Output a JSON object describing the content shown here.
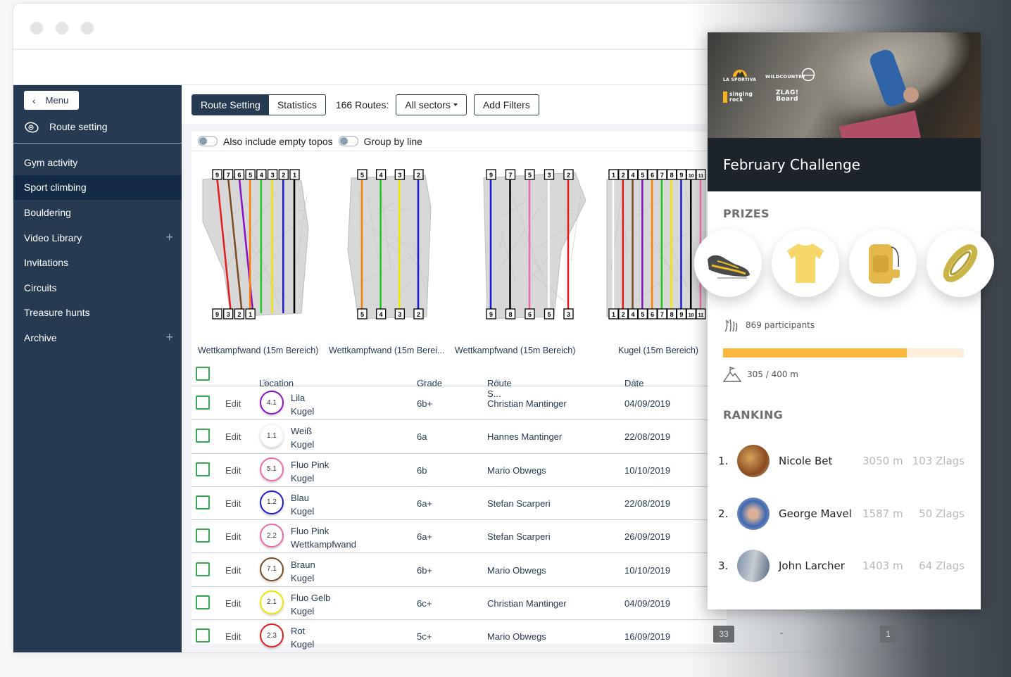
{
  "window": {
    "title_dots": [
      "close",
      "minimize",
      "maximize"
    ]
  },
  "sidebar": {
    "menu_button": "Menu",
    "section": {
      "label": "Route setting",
      "icon": "climbing-hold-icon"
    },
    "items": [
      {
        "label": "Gym activity",
        "active": false,
        "expandable": false
      },
      {
        "label": "Sport climbing",
        "active": true,
        "expandable": false
      },
      {
        "label": "Bouldering",
        "active": false,
        "expandable": false
      },
      {
        "label": "Video Library",
        "active": false,
        "expandable": true
      },
      {
        "label": "Invitations",
        "active": false,
        "expandable": false
      },
      {
        "label": "Circuits",
        "active": false,
        "expandable": false
      },
      {
        "label": "Treasure hunts",
        "active": false,
        "expandable": false
      },
      {
        "label": "Archive",
        "active": false,
        "expandable": true
      }
    ],
    "expand_symbol": "+"
  },
  "toolbar": {
    "tabs": [
      {
        "label": "Route Setting",
        "active": true
      },
      {
        "label": "Statistics",
        "active": false
      }
    ],
    "route_count": "166 Routes:",
    "sector_select": "All sectors",
    "add_filters": "Add Filters"
  },
  "toggles": [
    {
      "label": "Also include empty topos",
      "on": false
    },
    {
      "label": "Group by line",
      "on": false
    }
  ],
  "topos": [
    {
      "label": "Wettkampfwand (15m Bereich)",
      "top_numbers": [
        "9",
        "7",
        "6",
        "5",
        "4",
        "3",
        "2",
        "1"
      ],
      "bottom_numbers": [
        "9",
        "3",
        "2",
        "1"
      ]
    },
    {
      "label": "Wettkampfwand (15m Berei...",
      "top_numbers": [
        "5",
        "4",
        "3",
        "2"
      ],
      "bottom_numbers": [
        "5",
        "4",
        "3",
        "2"
      ]
    },
    {
      "label": "Wettkampfwand (15m Bereich)",
      "top_numbers": [
        "9",
        "7",
        "5",
        "3",
        "2"
      ],
      "bottom_numbers": [
        "9",
        "8",
        "6",
        "5",
        "3"
      ]
    },
    {
      "label": "Kugel (15m Bereich)",
      "top_numbers": [
        "1",
        "2",
        "4",
        "5",
        "6",
        "7",
        "8",
        "9",
        "10",
        "11"
      ],
      "bottom_numbers": [
        "1",
        "2",
        "4",
        "5",
        "6",
        "7",
        "8",
        "9",
        "10",
        "11"
      ]
    }
  ],
  "table": {
    "columns": [
      "Location",
      "Grade",
      "Route S...",
      "Date"
    ],
    "sort_icon": "⇅",
    "edit_label": "Edit",
    "rows": [
      {
        "number": "4.1",
        "color": "#8a12c4",
        "color_name": "Lila",
        "location": "Kugel",
        "grade": "6b+",
        "setter": "Christian Mantinger",
        "date": "04/09/2019"
      },
      {
        "number": "1.1",
        "color": "#ffffff",
        "color_name": "Weiß",
        "location": "Kugel",
        "grade": "6a",
        "setter": "Hannes Mantinger",
        "date": "22/08/2019"
      },
      {
        "number": "5.1",
        "color": "#f06aa8",
        "color_name": "Fluo Pink",
        "location": "Kugel",
        "grade": "6b",
        "setter": "Mario Obwegs",
        "date": "10/10/2019"
      },
      {
        "number": "1.2",
        "color": "#1a1ad6",
        "color_name": "Blau",
        "location": "Kugel",
        "grade": "6a+",
        "setter": "Stefan Scarperi",
        "date": "22/08/2019"
      },
      {
        "number": "2.2",
        "color": "#f06aa8",
        "color_name": "Fluo Pink",
        "location": "Wettkampfwand",
        "grade": "6a+",
        "setter": "Stefan Scarperi",
        "date": "26/09/2019"
      },
      {
        "number": "7.1",
        "color": "#7a4a22",
        "color_name": "Braun",
        "location": "Kugel",
        "grade": "6b+",
        "setter": "Mario Obwegs",
        "date": "10/10/2019"
      },
      {
        "number": "2.1",
        "color": "#f2e600",
        "color_name": "Fluo Gelb",
        "location": "Kugel",
        "grade": "6c+",
        "setter": "Christian Mantinger",
        "date": "04/09/2019"
      },
      {
        "number": "2.3",
        "color": "#e21c1c",
        "color_name": "Rot",
        "location": "Kugel",
        "grade": "5c+",
        "setter": "Mario Obwegs",
        "date": "16/09/2019"
      }
    ],
    "last_row_extra": {
      "count_badge": "33",
      "dash": "-",
      "page_badge": "1"
    }
  },
  "challenge": {
    "sponsors": [
      "LA SPORTIVA",
      "WILDCOUNTRY",
      "singing rock",
      "ZLAG! Board"
    ],
    "title": "February Challenge",
    "prizes_heading": "PRIZES",
    "prizes": [
      "climbing-shoe",
      "t-shirt",
      "backpack",
      "rope"
    ],
    "participants": "869 participants",
    "progress": {
      "current": 305,
      "goal": 400,
      "unit": "m",
      "label": "305 / 400 m"
    },
    "progress_fraction": 0.7625,
    "ranking_heading": "RANKING",
    "ranking": [
      {
        "position": "1.",
        "name": "Nicole Bet",
        "meters": "3050 m",
        "zlags": "103 Zlags"
      },
      {
        "position": "2.",
        "name": "George Mavel",
        "meters": "1587 m",
        "zlags": "50 Zlags"
      },
      {
        "position": "3.",
        "name": "John Larcher",
        "meters": "1403 m",
        "zlags": "64 Zlags"
      }
    ],
    "colors": {
      "accent": "#fbb83e",
      "title_bg": "#1c232b"
    }
  }
}
